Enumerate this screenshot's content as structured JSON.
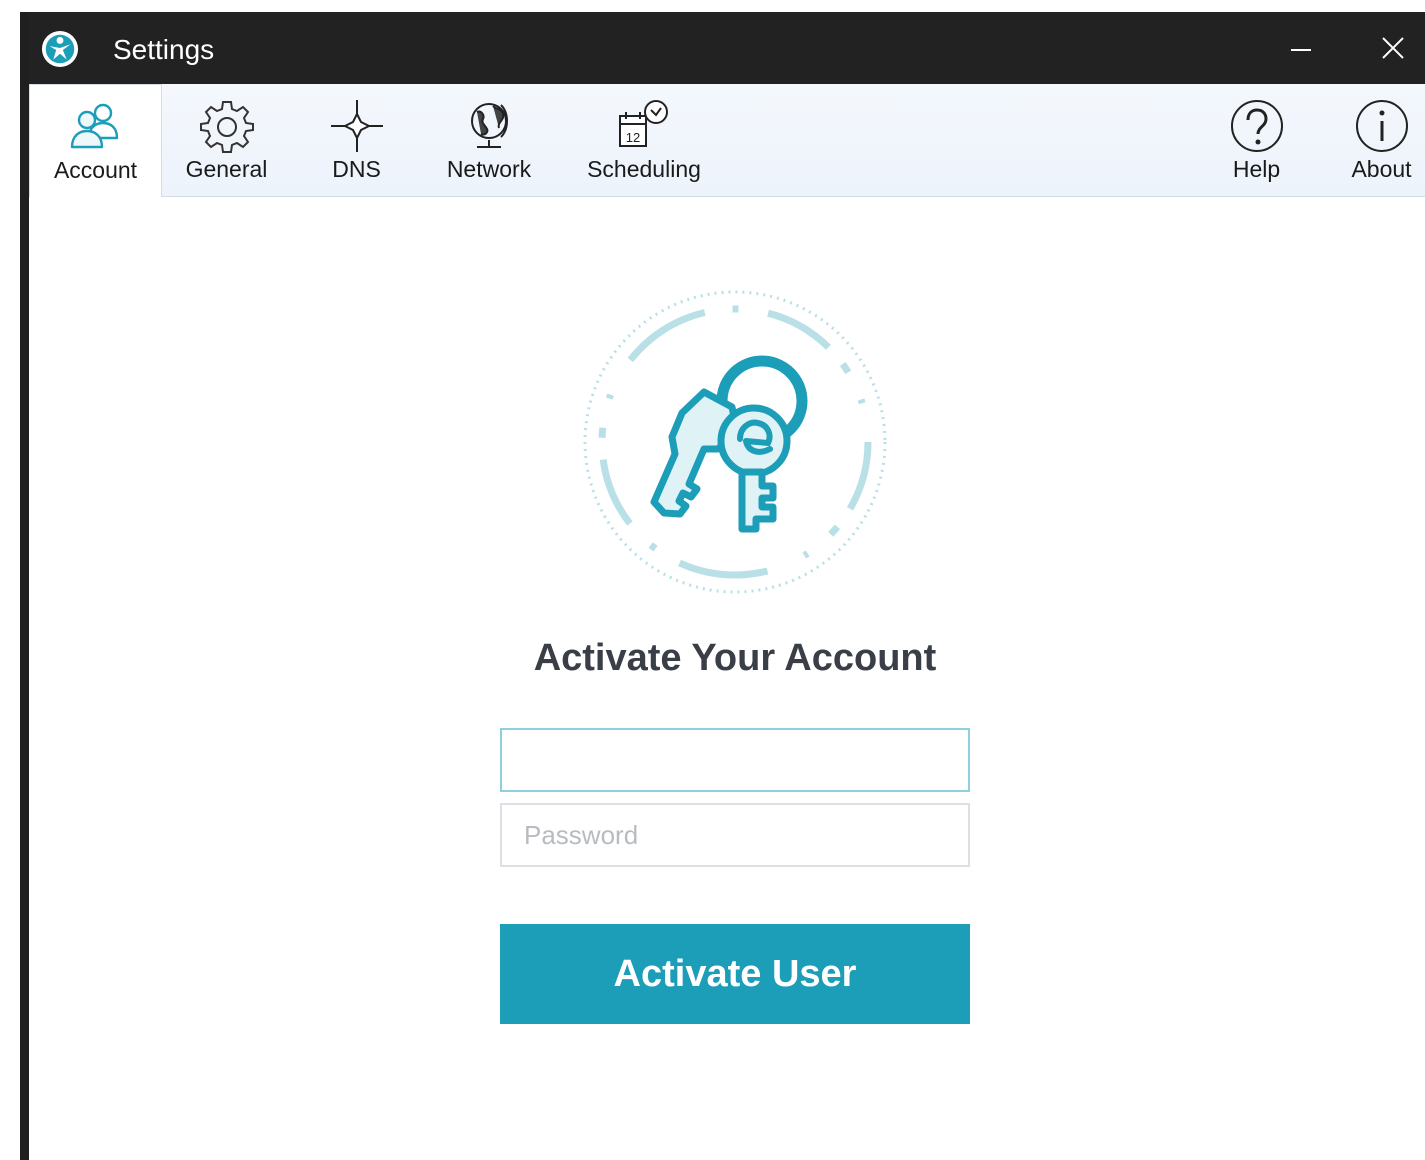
{
  "window": {
    "title": "Settings",
    "minimize_icon": "minimize-icon",
    "close_icon": "close-icon"
  },
  "toolbar": {
    "tabs": [
      {
        "label": "Account",
        "icon": "users-icon",
        "active": true
      },
      {
        "label": "General",
        "icon": "gear-icon",
        "active": false
      },
      {
        "label": "DNS",
        "icon": "crosshair-icon",
        "active": false
      },
      {
        "label": "Network",
        "icon": "globe-icon",
        "active": false
      },
      {
        "label": "Scheduling",
        "icon": "calendar-clock-icon",
        "active": false
      }
    ],
    "help": {
      "label": "Help",
      "icon": "question-circle-icon"
    },
    "about": {
      "label": "About",
      "icon": "info-circle-icon"
    }
  },
  "account": {
    "heading": "Activate Your Account",
    "email_value": "",
    "email_placeholder": "",
    "password_value": "",
    "password_placeholder": "Password",
    "submit_label": "Activate User"
  },
  "colors": {
    "accent": "#1c9db8",
    "titlebar": "#222222",
    "toolbar_bg": "#eef4fb",
    "heading_text": "#3a3f47"
  }
}
